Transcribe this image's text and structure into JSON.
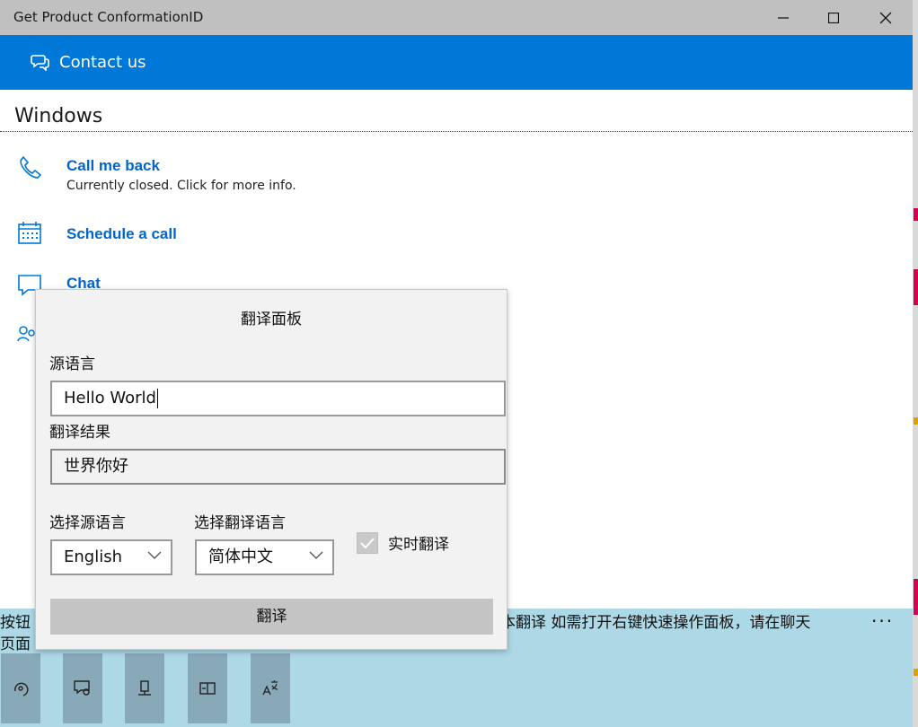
{
  "window": {
    "title": "Get Product ConformationID"
  },
  "header": {
    "title": "Contact us"
  },
  "section": {
    "title": "Windows"
  },
  "options": [
    {
      "title": "Call me back",
      "subtitle": "Currently closed. Click for more info."
    },
    {
      "title": "Schedule a call"
    },
    {
      "title": "Chat"
    }
  ],
  "panel": {
    "title": "翻译面板",
    "source_label": "源语言",
    "source_text": "Hello World",
    "result_label": "翻译结果",
    "result_text": "世界你好",
    "select_source_label": "选择源语言",
    "select_source_value": "English",
    "select_target_label": "选择翻译语言",
    "select_target_value": "简体中文",
    "realtime_label": "实时翻译",
    "realtime_checked": true,
    "translate_button": "翻译"
  },
  "strip": {
    "message_line1": "按钮",
    "message_line1_tail": "本翻译  如需打开右键快速操作面板，请在聊天",
    "message_line2": "页面",
    "more": "···"
  },
  "icons": [
    "chat-bubbles-icon",
    "phone-icon",
    "calendar-icon",
    "chat-icon",
    "people-icon",
    "assist-icon",
    "screen-share-icon",
    "remote-icon",
    "panel-icon",
    "translate-icon"
  ],
  "colors": {
    "accent": "#0078d7",
    "link": "#0066cc",
    "strip": "#add8e6",
    "titlebar": "#c0c0c0"
  }
}
